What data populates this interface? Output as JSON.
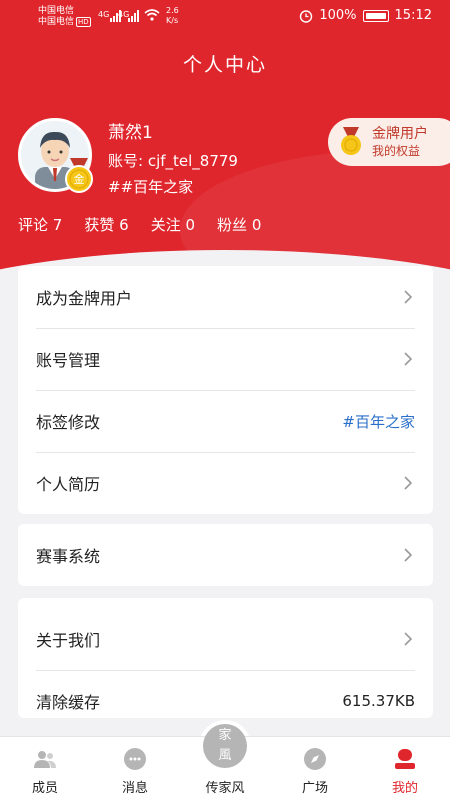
{
  "status_bar": {
    "carrier_1": "中国电信",
    "carrier_2": "中国电信",
    "hd": "HD",
    "net_1": "4G",
    "net_2": "4G",
    "speed_value": "2.6",
    "speed_unit": "K/s",
    "battery": "100%",
    "time": "15:12"
  },
  "header": {
    "title": "个人中心"
  },
  "profile": {
    "name": "萧然1",
    "account": "账号: cjf_tel_8779",
    "tag": "##百年之家",
    "badge_char": "金"
  },
  "stats": [
    {
      "label": "评论",
      "value": "7"
    },
    {
      "label": "获赞",
      "value": "6"
    },
    {
      "label": "关注",
      "value": "0"
    },
    {
      "label": "粉丝",
      "value": "0"
    }
  ],
  "gold_member": {
    "title": "金牌用户",
    "subtitle": "我的权益"
  },
  "menu_card_1": [
    {
      "label": "成为金牌用户"
    },
    {
      "label": "账号管理"
    },
    {
      "label": "标签修改",
      "value": "#百年之家"
    },
    {
      "label": "个人简历"
    }
  ],
  "menu_card_2": [
    {
      "label": "赛事系统"
    }
  ],
  "menu_card_3": [
    {
      "label": "关于我们"
    },
    {
      "label": "清除缓存",
      "value": "615.37KB"
    }
  ],
  "tabbar": {
    "items": [
      {
        "label": "成员",
        "icon": "members-icon"
      },
      {
        "label": "消息",
        "icon": "message-icon"
      },
      {
        "label": "传家风",
        "icon": "family-style-icon"
      },
      {
        "label": "广场",
        "icon": "compass-icon"
      },
      {
        "label": "我的",
        "icon": "profile-icon"
      }
    ],
    "center_glyph_1": "家",
    "center_glyph_2": "風",
    "active_color": "#e0262d"
  },
  "colors": {
    "brand_red": "#e0262d",
    "link_blue": "#2a6fc9"
  }
}
